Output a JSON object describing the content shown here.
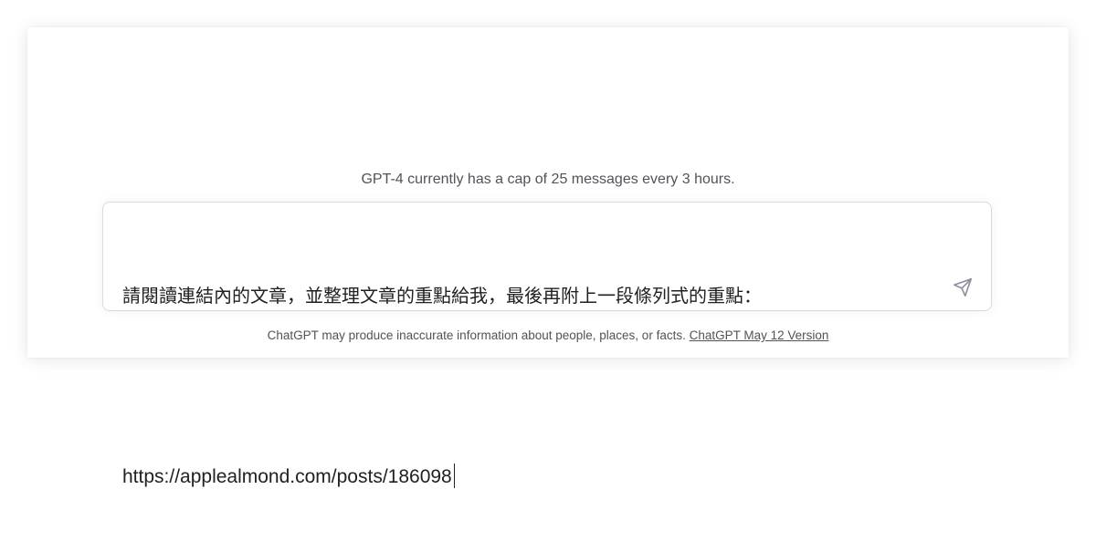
{
  "notice": {
    "cap_text": "GPT-4 currently has a cap of 25 messages every 3 hours."
  },
  "composer": {
    "line1": "請閱讀連結內的文章，並整理文章的重點給我，最後再附上一段條列式的重點：",
    "line2": "https://applealmond.com/posts/186098",
    "send_icon": "paper-plane-icon"
  },
  "footer": {
    "disclaimer": "ChatGPT may produce inaccurate information about people, places, or facts.",
    "version_link": "ChatGPT May 12 Version"
  },
  "colors": {
    "text_primary": "#202123",
    "text_secondary": "#52525b",
    "border": "#d9d9e3"
  }
}
